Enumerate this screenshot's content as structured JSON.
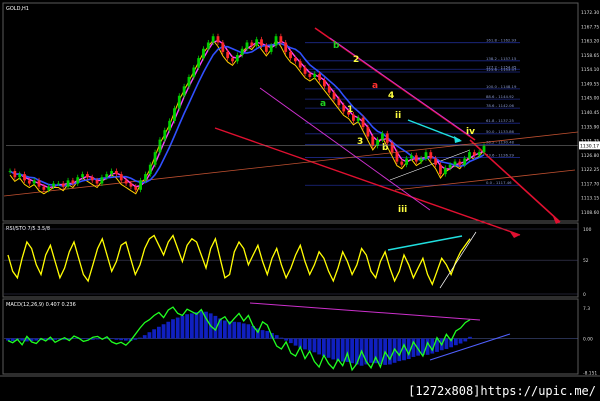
{
  "watermark": "[1272x808]https://upic.me/",
  "colors": {
    "background": "#000000",
    "frame": "#5a5a5a",
    "bull_candle": "#00d000",
    "bear_candle": "#ff2a2a",
    "price_line": "#ffffff",
    "ma_fast": "#ff40ff",
    "ma_slow": "#3050ff",
    "ma_mid": "#ffd000",
    "trend_red": "#e01030",
    "trend_magenta": "#cc30cc",
    "fib_lines": "#1e2a8a",
    "stoch_line": "#ffff00",
    "macd_hist": "#1020c0",
    "macd_line": "#20ff20",
    "annot_cyan": "#20e0e0"
  },
  "chart_data": [
    {
      "type": "candlestick",
      "title": "GOLD,H1",
      "ylim": [
        1107,
        1174
      ],
      "y_ticks": [
        "1172.30",
        "1167.75",
        "1163.20",
        "1158.65",
        "1154.10",
        "1149.55",
        "1145.00",
        "1140.45",
        "1135.90",
        "1131.35",
        "1126.80",
        "1122.25",
        "1117.70",
        "1113.15",
        "1108.60"
      ],
      "current_price": "1130.17",
      "fib_levels": [
        {
          "label": "161.8 - 1162.93",
          "value": 1162.93
        },
        {
          "label": "138.2 - 1157.15",
          "value": 1157.15
        },
        {
          "label": "127.2 - 1154.45",
          "value": 1154.45
        },
        {
          "label": "123.6 - 1153.57",
          "value": 1153.57
        },
        {
          "label": "100.0 - 1148.19",
          "value": 1148.19
        },
        {
          "label": "88.6 - 1144.92",
          "value": 1144.92
        },
        {
          "label": "78.6 - 1142.06",
          "value": 1142.06
        },
        {
          "label": "61.8 - 1137.25",
          "value": 1137.25
        },
        {
          "label": "50.0 - 1133.86",
          "value": 1133.86
        },
        {
          "label": "38.2 - 1130.48",
          "value": 1130.48
        },
        {
          "label": "23.6 - 1126.29",
          "value": 1126.29
        },
        {
          "label": "0.0 - 1117.46",
          "value": 1117.46
        }
      ],
      "wave_labels": [
        "b",
        "2",
        "a",
        "a",
        "1",
        "4",
        "3",
        "b",
        "ii",
        "iii",
        "iv"
      ],
      "close": [
        1122,
        1120,
        1121,
        1119,
        1118,
        1119,
        1117,
        1116,
        1117,
        1118,
        1118,
        1117,
        1119,
        1118,
        1120,
        1121,
        1120,
        1119,
        1118,
        1120,
        1121,
        1122,
        1121,
        1119,
        1118,
        1117,
        1116,
        1119,
        1121,
        1124,
        1128,
        1132,
        1135,
        1138,
        1142,
        1146,
        1149,
        1152,
        1155,
        1158,
        1161,
        1163,
        1165,
        1163,
        1160,
        1158,
        1157,
        1159,
        1161,
        1163,
        1162,
        1164,
        1162,
        1160,
        1162,
        1165,
        1163,
        1160,
        1158,
        1157,
        1155,
        1153,
        1152,
        1153,
        1151,
        1149,
        1147,
        1145,
        1143,
        1141,
        1140,
        1138,
        1139,
        1136,
        1133,
        1130,
        1132,
        1134,
        1131,
        1128,
        1125,
        1124,
        1126,
        1127,
        1125,
        1126,
        1128,
        1126,
        1124,
        1121,
        1123,
        1124,
        1125,
        1124,
        1126,
        1128,
        1127,
        1128,
        1130
      ]
    },
    {
      "type": "line",
      "title": "RSI/STO 7/5 3.5/8",
      "ylim": [
        0,
        100
      ],
      "y_ticks": [
        "100",
        "52",
        "0"
      ],
      "values": [
        60,
        35,
        25,
        55,
        80,
        70,
        45,
        30,
        60,
        75,
        50,
        25,
        40,
        65,
        80,
        55,
        30,
        20,
        45,
        70,
        85,
        60,
        35,
        50,
        75,
        80,
        55,
        30,
        45,
        70,
        85,
        90,
        75,
        60,
        80,
        90,
        70,
        50,
        75,
        85,
        80,
        60,
        40,
        70,
        85,
        55,
        25,
        30,
        65,
        80,
        70,
        45,
        60,
        75,
        50,
        30,
        55,
        70,
        45,
        25,
        40,
        60,
        75,
        50,
        30,
        45,
        65,
        55,
        35,
        20,
        40,
        65,
        50,
        30,
        45,
        70,
        60,
        35,
        25,
        50,
        65,
        40,
        20,
        35,
        60,
        45,
        25,
        40,
        55,
        30,
        15,
        35,
        55,
        45,
        30,
        50,
        65,
        75,
        85
      ]
    },
    {
      "type": "bar",
      "title": "MACD(12,26,9) 0.407 0.236",
      "ylim": [
        -8,
        8
      ],
      "y_ticks": [
        "7.3",
        "0.00",
        "-8.151"
      ],
      "histogram": [
        -0.5,
        -0.6,
        -0.4,
        -0.5,
        -0.7,
        -0.6,
        -0.5,
        -0.4,
        -0.3,
        -0.4,
        -0.3,
        -0.2,
        -0.3,
        -0.2,
        -0.1,
        0.0,
        -0.1,
        -0.2,
        -0.3,
        -0.2,
        -0.1,
        0.0,
        -0.1,
        -0.3,
        -0.4,
        -0.5,
        -0.6,
        -0.3,
        0.2,
        0.8,
        1.5,
        2.2,
        2.8,
        3.4,
        4.0,
        4.6,
        5.0,
        5.4,
        5.8,
        6.0,
        6.3,
        6.5,
        6.4,
        6.0,
        5.4,
        4.8,
        4.3,
        4.1,
        4.0,
        3.9,
        3.6,
        3.4,
        3.0,
        2.4,
        2.0,
        1.8,
        1.3,
        0.8,
        0.2,
        -0.5,
        -1.1,
        -1.7,
        -2.2,
        -2.6,
        -2.9,
        -3.3,
        -3.8,
        -4.2,
        -4.6,
        -5.0,
        -5.3,
        -5.5,
        -5.6,
        -5.9,
        -6.2,
        -6.5,
        -6.2,
        -5.8,
        -5.9,
        -6.1,
        -6.3,
        -6.2,
        -5.8,
        -5.4,
        -5.2,
        -4.9,
        -4.4,
        -4.1,
        -3.9,
        -3.9,
        -3.6,
        -3.2,
        -2.8,
        -2.5,
        -2.1,
        -1.6,
        -1.2,
        -0.7,
        0.4
      ],
      "macd_line": [
        -0.5,
        -1.0,
        -0.2,
        -1.5,
        0.5,
        -0.8,
        -1.2,
        0.0,
        -0.6,
        0.3,
        -0.9,
        -0.3,
        0.2,
        -0.5,
        0.6,
        0.1,
        -0.7,
        -0.4,
        0.3,
        0.5,
        -0.2,
        0.4,
        -0.8,
        -1.3,
        -0.9,
        -1.6,
        -0.5,
        1.0,
        2.5,
        3.8,
        4.5,
        5.5,
        6.2,
        5.0,
        6.8,
        7.5,
        6.0,
        5.5,
        7.0,
        6.4,
        5.8,
        6.9,
        4.8,
        3.0,
        2.0,
        4.5,
        5.2,
        3.5,
        4.8,
        6.0,
        4.2,
        5.5,
        3.0,
        1.5,
        4.0,
        3.2,
        0.5,
        -1.8,
        -2.5,
        -0.8,
        -3.5,
        -4.2,
        -2.0,
        -4.8,
        -3.0,
        -5.5,
        -6.8,
        -4.0,
        -6.0,
        -7.2,
        -5.0,
        -6.5,
        -3.5,
        -7.5,
        -6.0,
        -3.0,
        -5.5,
        -7.0,
        -4.5,
        -6.8,
        -3.2,
        -5.0,
        -2.5,
        -4.0,
        -1.5,
        -3.8,
        -0.8,
        -2.5,
        -4.2,
        -1.0,
        -2.8,
        0.2,
        -1.5,
        1.0,
        -0.5,
        1.8,
        2.5,
        3.8,
        4.5
      ]
    }
  ]
}
